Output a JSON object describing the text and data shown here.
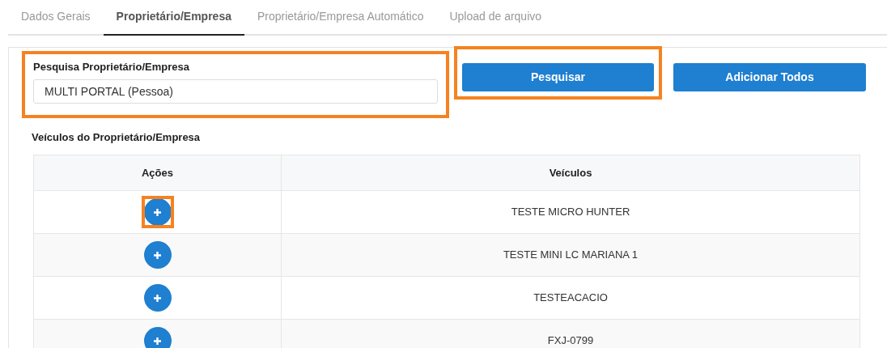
{
  "tabs": [
    {
      "label": "Dados Gerais",
      "selected": false
    },
    {
      "label": "Proprietário/Empresa",
      "selected": true
    },
    {
      "label": "Proprietário/Empresa Automático",
      "selected": false
    },
    {
      "label": "Upload de arquivo",
      "selected": false
    }
  ],
  "search": {
    "label": "Pesquisa Proprietário/Empresa",
    "value": "MULTI PORTAL (Pessoa)",
    "highlighted": true
  },
  "buttons": [
    {
      "label": "Pesquisar",
      "highlighted": true
    },
    {
      "label": "Adicionar Todos",
      "highlighted": false
    }
  ],
  "vehicles": {
    "title": "Veículos do Proprietário/Empresa",
    "columns": [
      "Ações",
      "Veículos"
    ],
    "rows": [
      {
        "vehicle": "TESTE MICRO HUNTER",
        "highlighted": true
      },
      {
        "vehicle": "TESTE MINI LC MARIANA 1",
        "highlighted": false
      },
      {
        "vehicle": "TESTEACACIO",
        "highlighted": false
      },
      {
        "vehicle": "FXJ-0799",
        "highlighted": false
      }
    ]
  }
}
